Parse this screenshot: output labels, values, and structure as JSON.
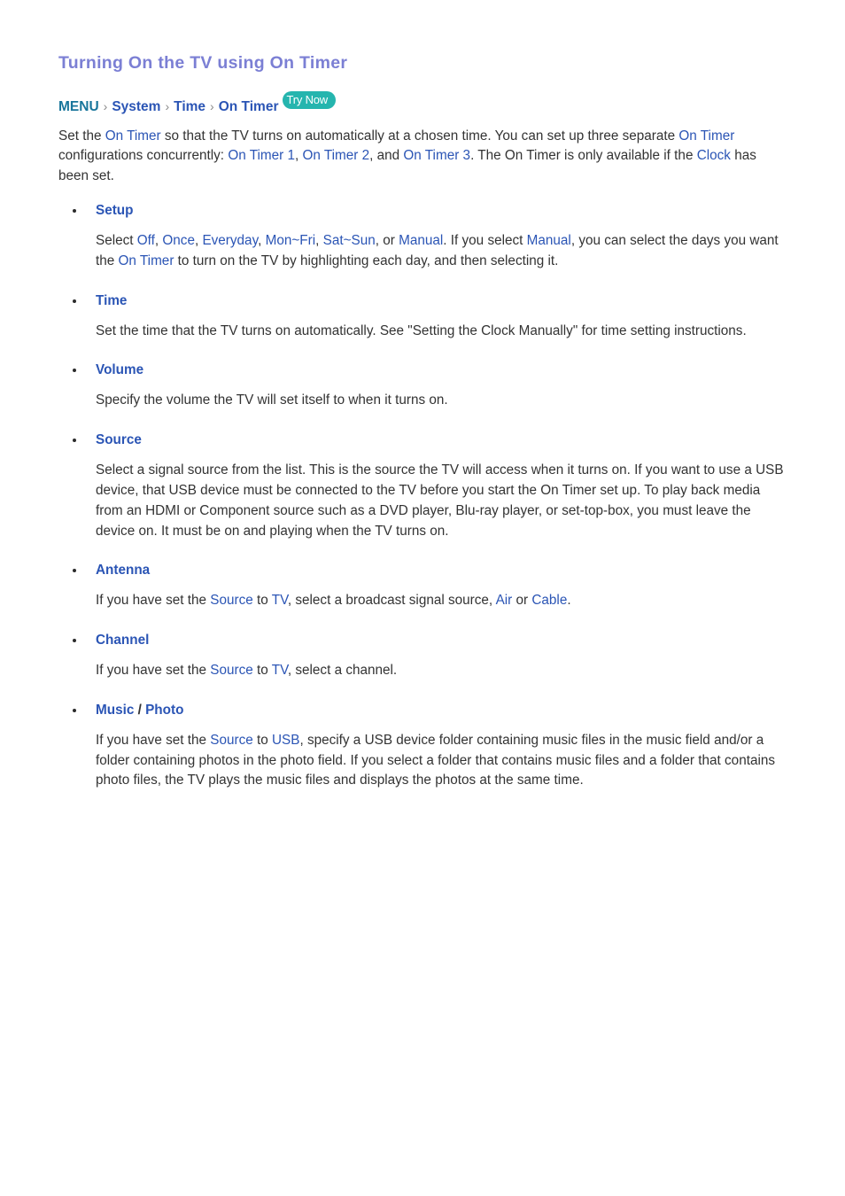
{
  "page": {
    "title": "Turning On the TV using On Timer"
  },
  "breadcrumb": {
    "menu": "MENU",
    "separator": "›",
    "items": [
      "System",
      "Time",
      "On Timer"
    ],
    "try_now_label": "Try Now",
    "try_now_color": "#25b5ae"
  },
  "intro": {
    "s1": "Set the ",
    "l1": "On Timer",
    "s2": " so that the TV turns on automatically at a chosen time. You can set up three separate ",
    "l2": "On Timer",
    "s3": " configurations concurrently: ",
    "l3": "On Timer 1",
    "s4": ", ",
    "l4": "On Timer 2",
    "s5": ", and ",
    "l5": "On Timer 3",
    "s6": ". The On Timer is only available if the ",
    "l6": "Clock",
    "s7": " has been set."
  },
  "sections": {
    "setup": {
      "label": "Setup",
      "s1": "Select ",
      "o1": "Off",
      "s2": ", ",
      "o2": "Once",
      "s3": ", ",
      "o3": "Everyday",
      "s4": ", ",
      "o4": "Mon~Fri",
      "s5": ", ",
      "o5": "Sat~Sun",
      "s6": ", or ",
      "o6": "Manual",
      "s7": ". If you select ",
      "o7": "Manual",
      "s8": ", you can select the days you want the ",
      "o8": "On Timer",
      "s9": " to turn on the TV by highlighting each day, and then selecting it."
    },
    "time": {
      "label": "Time",
      "body": "Set the time that the TV turns on automatically. See \"Setting the Clock Manually\" for time setting instructions."
    },
    "volume": {
      "label": "Volume",
      "body": "Specify the volume the TV will set itself to when it turns on."
    },
    "source": {
      "label": "Source",
      "body": "Select a signal source from the list. This is the source the TV will access when it turns on. If you want to use a USB device, that USB device must be connected to the TV before you start the On Timer set up. To play back media from an HDMI or Component source such as a DVD player, Blu-ray player, or set-top-box, you must leave the device on. It must be on and playing when the TV turns on."
    },
    "antenna": {
      "label": "Antenna",
      "s1": "If you have set the ",
      "l1": "Source",
      "s2": " to ",
      "l2": "TV",
      "s3": ", select a broadcast signal source, ",
      "l3": "Air",
      "s4": " or ",
      "l4": "Cable",
      "s5": "."
    },
    "channel": {
      "label": "Channel",
      "s1": "If you have set the ",
      "l1": "Source",
      "s2": " to ",
      "l2": "TV",
      "s3": ", select a channel."
    },
    "music_photo": {
      "label_music": "Music",
      "label_separator": "/",
      "label_photo": "Photo",
      "s1": "If you have set the ",
      "l1": "Source",
      "s2": " to ",
      "l2": "USB",
      "s3": ", specify a USB device folder containing music files in the music field and/or a folder containing photos in the photo field. If you select a folder that contains music files and a folder that contains photo files, the TV plays the music files and displays the photos at the same time."
    }
  }
}
